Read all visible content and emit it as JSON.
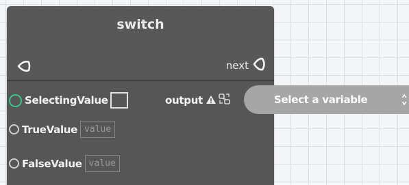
{
  "node": {
    "title": "switch",
    "next_label": "next",
    "fields": [
      {
        "label": "SelectingValue",
        "active": true
      },
      {
        "label": "TrueValue",
        "placeholder": "value"
      },
      {
        "label": "FalseValue",
        "placeholder": "value"
      }
    ],
    "output": {
      "label": "output",
      "variable_placeholder": "Select a variable"
    }
  },
  "colors": {
    "node_bg": "#565656",
    "active_radio": "#3cc48a",
    "select_bg": "#a6a6a6",
    "canvas_bg": "#f4f5f7"
  },
  "icons": [
    "port-in-icon",
    "port-out-icon",
    "warning-icon",
    "link-icon",
    "chevron-icon"
  ]
}
